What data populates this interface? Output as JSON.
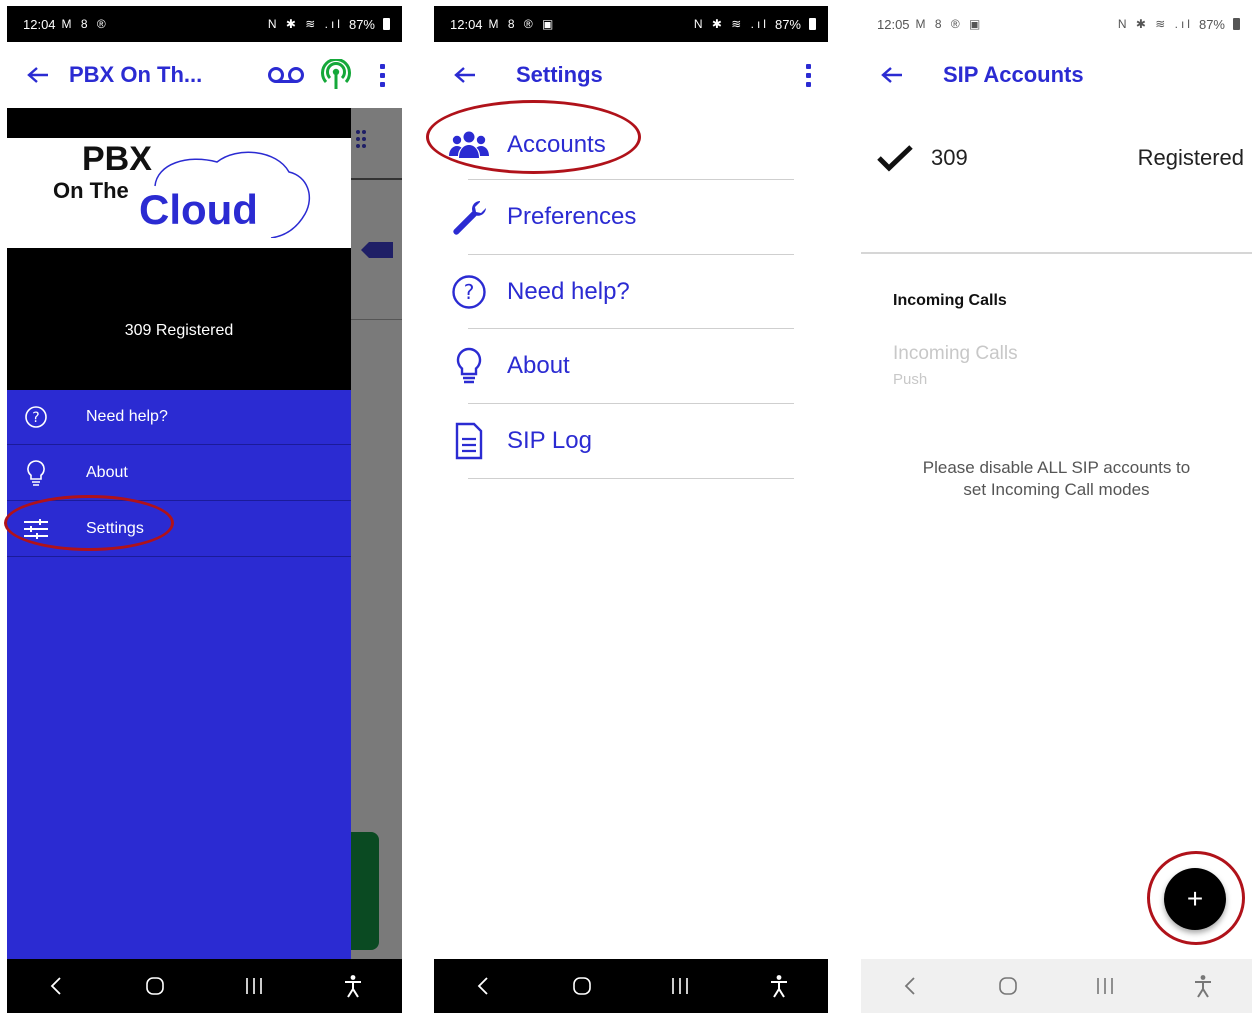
{
  "phone1": {
    "status": {
      "time": "12:04",
      "left_icons": "M 8 ®",
      "right_icons": "N ✱ ≋ .ıl",
      "battery": "87%"
    },
    "appbar": {
      "title": "PBX On Th..."
    },
    "logo": {
      "line1": "PBX",
      "line2": "On The",
      "line3": "Cloud"
    },
    "account_line": "309  Registered",
    "menu": [
      {
        "label": "Need help?",
        "icon": "help-circle-icon"
      },
      {
        "label": "About",
        "icon": "lightbulb-icon"
      },
      {
        "label": "Settings",
        "icon": "sliders-icon"
      }
    ]
  },
  "phone2": {
    "status": {
      "time": "12:04",
      "left_icons": "M 8 ® ▣",
      "right_icons": "N ✱ ≋ .ıl",
      "battery": "87%"
    },
    "appbar": {
      "title": "Settings"
    },
    "items": [
      {
        "label": "Accounts",
        "icon": "users-icon"
      },
      {
        "label": "Preferences",
        "icon": "wrench-icon"
      },
      {
        "label": "Need help?",
        "icon": "help-circle-icon"
      },
      {
        "label": "About",
        "icon": "lightbulb-icon"
      },
      {
        "label": "SIP Log",
        "icon": "document-icon"
      }
    ]
  },
  "phone3": {
    "status": {
      "time": "12:05",
      "left_icons": "M 8 ® ▣",
      "right_icons": "N ✱ ≋ .ıl",
      "battery": "87%"
    },
    "appbar": {
      "title": "SIP Accounts"
    },
    "account": {
      "name": "309",
      "status": "Registered"
    },
    "incoming": {
      "header": "Incoming Calls",
      "title": "Incoming Calls",
      "subtitle": "Push",
      "message": "Please disable ALL SIP accounts to set Incoming Call modes"
    },
    "fab_label": "+"
  },
  "colors": {
    "brand": "#2b2bd2",
    "annotation": "#b0121a"
  }
}
